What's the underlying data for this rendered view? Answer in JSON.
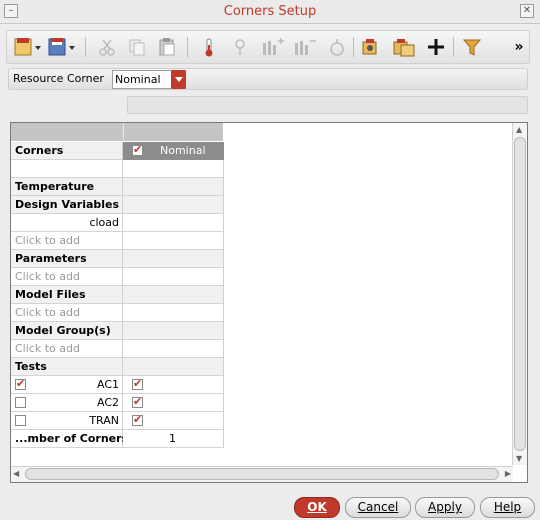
{
  "window": {
    "title": "Corners Setup"
  },
  "toolbar": {
    "icons": [
      "csv-import-icon",
      "csv-save-icon",
      "cut-icon",
      "copy-icon",
      "paste-icon",
      "thermometer-icon",
      "add-parameter-icon",
      "add-model-icon",
      "remove-model-icon",
      "sweep-icon",
      "group-icon",
      "group-add-icon",
      "plus-icon",
      "filter-icon"
    ],
    "overflow": "»"
  },
  "resource_corner": {
    "label": "Resource Corner",
    "value": "Nominal"
  },
  "grid": {
    "corner_header": "Nominal",
    "rows": [
      {
        "label": "Corners",
        "kind": "corners"
      },
      {
        "label": "",
        "kind": "blank"
      },
      {
        "label": "Temperature",
        "kind": "section"
      },
      {
        "label": "Design Variables",
        "kind": "section"
      },
      {
        "label": "cload",
        "kind": "var"
      },
      {
        "label": "Click to add",
        "kind": "placeholder"
      },
      {
        "label": "Parameters",
        "kind": "section"
      },
      {
        "label": "Click to add",
        "kind": "placeholder"
      },
      {
        "label": "Model Files",
        "kind": "section"
      },
      {
        "label": "Click to add",
        "kind": "placeholder"
      },
      {
        "label": "Model Group(s)",
        "kind": "section"
      },
      {
        "label": "Click to add",
        "kind": "placeholder"
      },
      {
        "label": "Tests",
        "kind": "section"
      },
      {
        "label": "AC1",
        "kind": "test",
        "enabled": true,
        "corner": true
      },
      {
        "label": "AC2",
        "kind": "test",
        "enabled": false,
        "corner": true
      },
      {
        "label": "TRAN",
        "kind": "test",
        "enabled": false,
        "corner": true
      },
      {
        "label": "...mber of Corners",
        "kind": "count",
        "value": "1"
      }
    ]
  },
  "buttons": {
    "ok": "OK",
    "cancel": "Cancel",
    "apply": "Apply",
    "help": "Help"
  },
  "colors": {
    "accent": "#c0392b"
  }
}
